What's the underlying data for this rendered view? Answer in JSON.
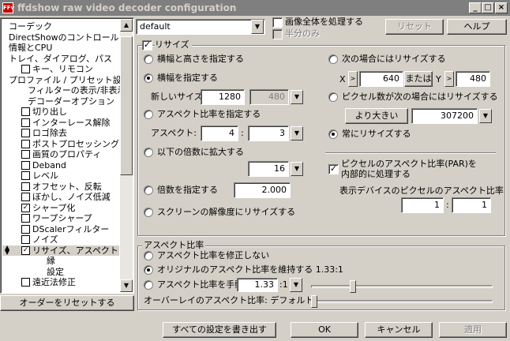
{
  "window": {
    "title": "ffdshow raw video decoder configuration",
    "icon_text": "FFv"
  },
  "tree": [
    {
      "label": "コーデック",
      "indent": 0,
      "check": null
    },
    {
      "label": "DirectShowのコントロール",
      "indent": 0,
      "check": null
    },
    {
      "label": "情報とCPU",
      "indent": 0,
      "check": null
    },
    {
      "label": "トレイ、ダイアログ、パス",
      "indent": 0,
      "check": null
    },
    {
      "label": "キー、リモコン",
      "indent": 1,
      "check": false
    },
    {
      "label": "プロファイル / プリセット設定",
      "indent": 0,
      "check": null
    },
    {
      "label": "フィルターの表示/非表示",
      "indent": 2,
      "check": null
    },
    {
      "label": "デコーダーオプション",
      "indent": 2,
      "check": null
    },
    {
      "label": "切り出し",
      "indent": 1,
      "check": false
    },
    {
      "label": "インターレース解除",
      "indent": 1,
      "check": false
    },
    {
      "label": "ロゴ除去",
      "indent": 1,
      "check": false
    },
    {
      "label": "ポストプロセッシング",
      "indent": 1,
      "check": false
    },
    {
      "label": "画質のプロパティ",
      "indent": 1,
      "check": false
    },
    {
      "label": "Deband",
      "indent": 1,
      "check": false
    },
    {
      "label": "レベル",
      "indent": 1,
      "check": false
    },
    {
      "label": "オフセット、反転",
      "indent": 1,
      "check": false
    },
    {
      "label": "ぼかし、ノイズ低減",
      "indent": 1,
      "check": false
    },
    {
      "label": "シャープ化",
      "indent": 1,
      "check": true
    },
    {
      "label": "ワープシャープ",
      "indent": 1,
      "check": false
    },
    {
      "label": "DScalerフィルター",
      "indent": 1,
      "check": false
    },
    {
      "label": "ノイズ",
      "indent": 1,
      "check": false
    },
    {
      "label": "リサイズ、アスペクト",
      "indent": 1,
      "check": true,
      "selected": true,
      "updown": true
    },
    {
      "label": "縁",
      "indent": 3,
      "check": null
    },
    {
      "label": "設定",
      "indent": 3,
      "check": null
    },
    {
      "label": "遠近法修正",
      "indent": 1,
      "check": false
    }
  ],
  "reset_order_label": "オーダーをリセットする",
  "top": {
    "preset_value": "default",
    "process_whole_label": "画像全体を処理する",
    "half_only_label": "半分のみ",
    "reset_label": "リセット",
    "help_label": "ヘルプ"
  },
  "resize": {
    "group_label": "リサイズ",
    "enabled": true,
    "opt_wh": "横幅と高さを指定する",
    "opt_w": "横幅を指定する",
    "new_size_label": "新しいサイズ:",
    "new_w": "1280",
    "new_h": "480",
    "opt_aspect": "アスペクト比率を指定する",
    "aspect_label": "アスペクト:",
    "aspect_a": "4",
    "aspect_sep": ":",
    "aspect_b": "3",
    "opt_scale": "以下の倍数に拡大する",
    "scale_value": "16",
    "opt_mult": "倍数を指定する",
    "mult_value": "2.000",
    "opt_screen": "スクリーンの解像度にリサイズする",
    "cond_label": "次の場合にはリサイズする",
    "x_label": "X",
    "gt": ">",
    "x_value": "640",
    "or_label": "または",
    "y_label": "Y",
    "y_value": "480",
    "pix_label": "ピクセル数が次の場合にはリサイズする",
    "pix_cmp": "より大きい",
    "pix_value": "307200",
    "always_label": "常にリサイズする",
    "par_label_1": "ピクセルのアスペクト比率(PAR)を",
    "par_label_2": "内部的に処理する",
    "par_disp_label": "表示デバイスのピクセルのアスペクト比率",
    "par_a": "1",
    "par_sep": ":",
    "par_b": "1"
  },
  "aspect": {
    "group_label": "アスペクト比率",
    "opt_nofix": "アスペクト比率を修正しない",
    "opt_keep": "オリジナルのアスペクト比率を維持する 1.33:1",
    "opt_manual": "アスペクト比率を手動",
    "manual_value": "1.33",
    "manual_suffix": ":1",
    "overlay_label": "オーバーレイのアスペクト比率: デフォルト",
    "manual_slider": 0.22,
    "overlay_slider": 0.0
  },
  "bottom": {
    "write_all_label": "すべての設定を書き出す",
    "ok_label": "OK",
    "cancel_label": "キャンセル",
    "apply_label": "適用"
  },
  "selection": {
    "aspect_mode": "keep",
    "resize_mode": "width",
    "cond_mode": "always"
  }
}
